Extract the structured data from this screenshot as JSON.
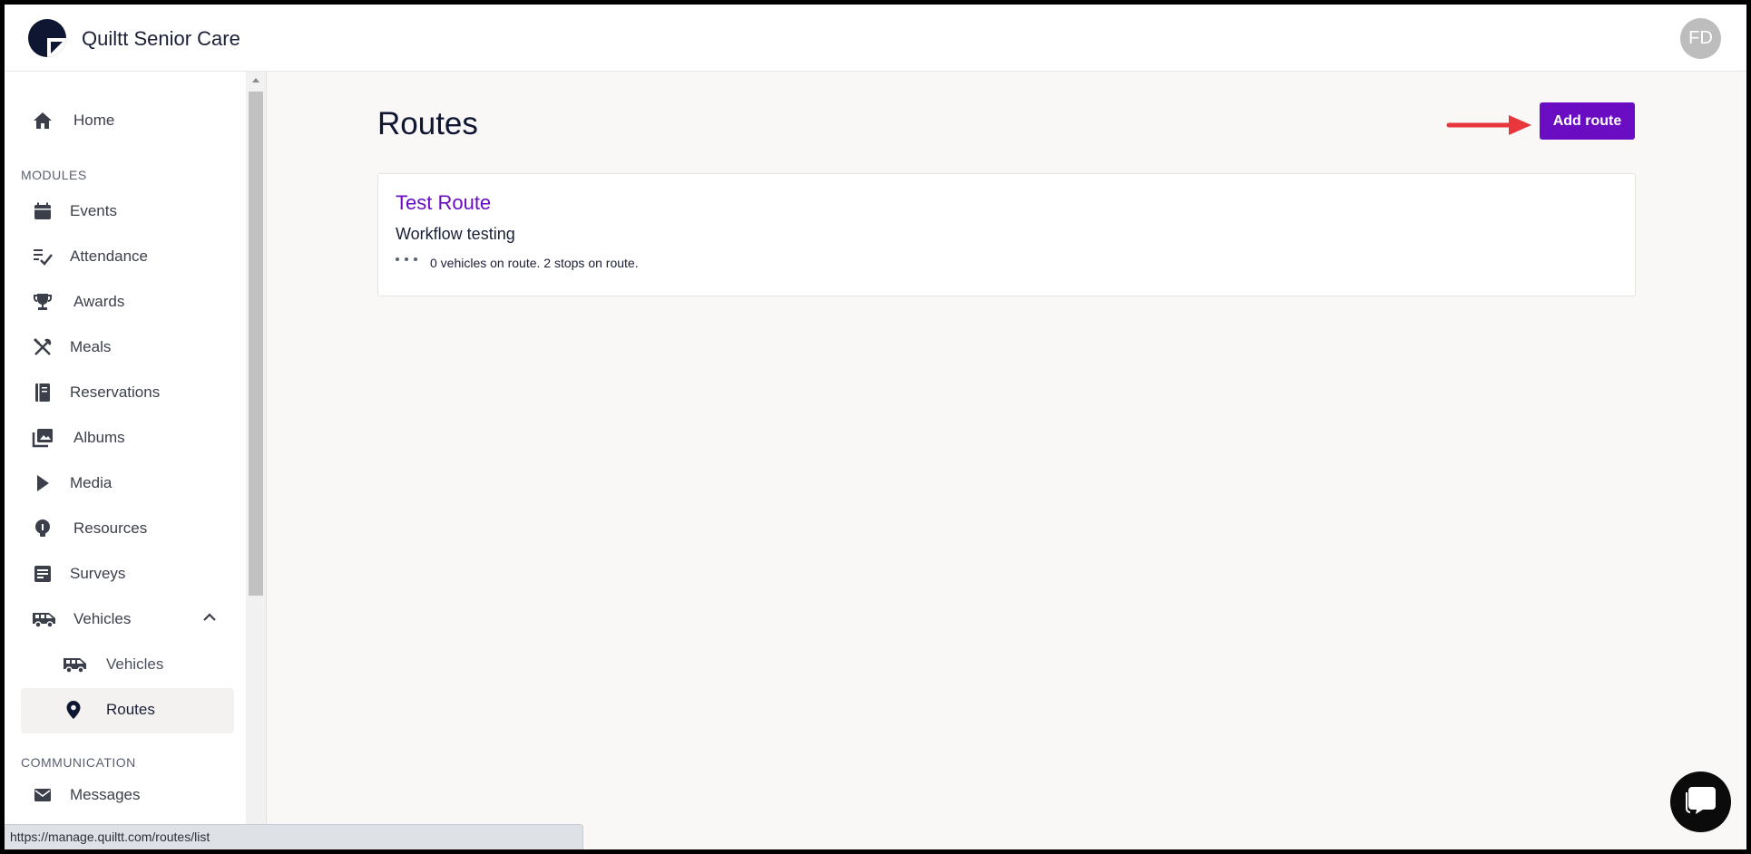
{
  "app": {
    "brand": "Quiltt Senior Care",
    "avatar_initials": "FD"
  },
  "sidebar": {
    "home": "Home",
    "modules_title": "MODULES",
    "items": [
      {
        "label": "Events",
        "icon": "calendar-icon"
      },
      {
        "label": "Attendance",
        "icon": "checklist-icon"
      },
      {
        "label": "Awards",
        "icon": "trophy-icon"
      },
      {
        "label": "Meals",
        "icon": "utensils-icon"
      },
      {
        "label": "Reservations",
        "icon": "book-icon"
      },
      {
        "label": "Albums",
        "icon": "photo-library-icon"
      },
      {
        "label": "Media",
        "icon": "play-icon"
      },
      {
        "label": "Resources",
        "icon": "lightbulb-icon"
      },
      {
        "label": "Surveys",
        "icon": "survey-icon"
      },
      {
        "label": "Vehicles",
        "icon": "bus-icon"
      }
    ],
    "sub_items": [
      {
        "label": "Vehicles",
        "icon": "bus-icon"
      },
      {
        "label": "Routes",
        "icon": "location-pin-icon"
      }
    ],
    "communication_title": "COMMUNICATION",
    "messages": "Messages"
  },
  "main": {
    "title": "Routes",
    "add_button": "Add route",
    "route": {
      "name": "Test Route",
      "description": "Workflow testing",
      "meta": "0 vehicles on route. 2 stops on route."
    }
  },
  "status_url": "https://manage.quiltt.com/routes/list",
  "colors": {
    "accent": "#6a0dc2",
    "annotation_arrow": "#e8363c",
    "navy": "#0f1631"
  }
}
